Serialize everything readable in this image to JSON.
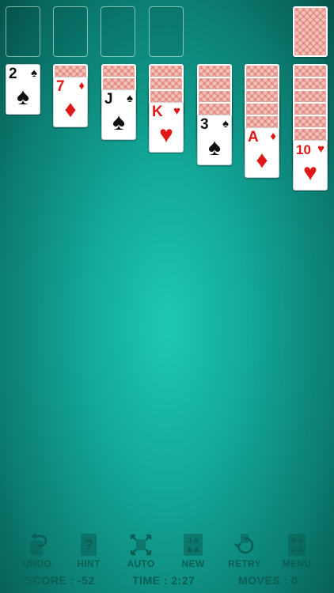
{
  "columns": [
    {
      "rank": "2",
      "suit": "♠",
      "color": "black"
    },
    {
      "rank": "7",
      "suit": "♦",
      "color": "red"
    },
    {
      "rank": "J",
      "suit": "♠",
      "color": "black"
    },
    {
      "rank": "K",
      "suit": "♥",
      "color": "red"
    },
    {
      "rank": "3",
      "suit": "♠",
      "color": "black"
    },
    {
      "rank": "A",
      "suit": "♦",
      "color": "red"
    },
    {
      "rank": "10",
      "suit": "♥",
      "color": "red"
    }
  ],
  "toolbar": {
    "undo": "UNDO",
    "hint": "HINT",
    "auto": "AUTO",
    "new": "NEW",
    "retry": "RETRY",
    "menu": "MENU"
  },
  "status": {
    "score": "SCORE : -52",
    "time": "TIME : 2:27",
    "moves": "MOVES : 0"
  },
  "colors": {
    "felt": "#13a899",
    "card_red": "#e01818",
    "label": "#0a5e56"
  }
}
